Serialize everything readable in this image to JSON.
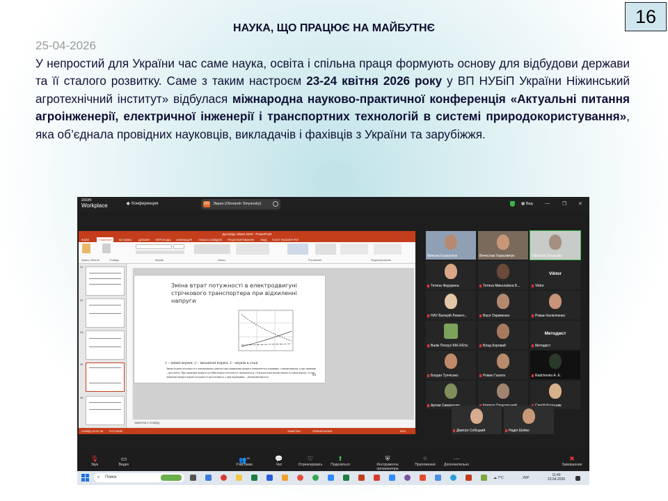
{
  "slide": {
    "title": "НАУКА, ЩО ПРАЦЮЄ НА МАЙБУТНЄ",
    "page_number": "16",
    "date": "25-04-2026",
    "p1": "У непростий для України час саме наука, освіта і спільна праця формують основу для відбудови держави та її сталого розвитку. Саме з таким настроєм ",
    "p2_bold": "23-24 квітня 2026 року",
    "p3": " у ВП НУБіП України Ніжинський агротехнічний інститут» відбулася ",
    "p4_bold": "міжнародна науково-практичної конференція «Актуальні питання агроінженерії, електричної інженерії і транспортних технологій в системі природокористування»",
    "p5": ", яка об’єднала провідних науковців, викладачів і фахівців з України та зарубіжжя."
  },
  "zoom": {
    "logo_top": "zoom",
    "logo_bottom": "Workplace",
    "conference_label": "Конференция",
    "screen_badge": "OS",
    "screen_label": "Экран (Olexandr Sinyavsky)",
    "view_label": "Вид",
    "controls": {
      "audio": "Звук",
      "video": "Видео",
      "participants": "Участники",
      "participants_count": "20",
      "chat": "Чат",
      "react": "Отреагировать",
      "share": "Поделиться",
      "host_tools": "Инструменты организатора",
      "apps": "Приложения",
      "more": "Дополнительно",
      "end": "Завершение"
    },
    "participants": [
      {
        "name": "Микола Іськальчук"
      },
      {
        "name": "Вячеслав Герасимчук"
      },
      {
        "name": "Olexandr Sinyavsky"
      },
      {
        "name": "Тетяна Федорина"
      },
      {
        "name": "Тетяна Миколаївна Б..."
      },
      {
        "name": "Viktor",
        "big": "Viktor"
      },
      {
        "name": "НАУ Валерій Лемент..."
      },
      {
        "name": "Вася Окрименко"
      },
      {
        "name": "Роман Калініченко"
      },
      {
        "name": "Валік Петрух БМ-242ск"
      },
      {
        "name": "Влад Коровай"
      },
      {
        "name": "Методист",
        "big": "Методист"
      },
      {
        "name": "Богдан Тупчієнко"
      },
      {
        "name": "Роман Галата"
      },
      {
        "name": "Radchenko A. E."
      },
      {
        "name": "Артем Симоненко"
      },
      {
        "name": "Кирилл Одосовський"
      },
      {
        "name": "Сергій Колєсник"
      },
      {
        "name": "Дмитро Собіщкий"
      },
      {
        "name": "Надія Шейко"
      }
    ]
  },
  "ppt": {
    "window_title": "Доповідь Ніжин 2026 - PowerPoint",
    "tabs": [
      "ФАЙЛ",
      "ГЛАВНАЯ",
      "ВСТАВКА",
      "ДИЗАЙН",
      "ПЕРЕХОДЫ",
      "АНИМАЦИЯ",
      "ПОКАЗ СЛАЙДОВ",
      "РЕЦЕНЗИРОВАНИЕ",
      "ВИД",
      "FOXIT READER PDF"
    ],
    "ribbon_groups": [
      "Буфер обмена",
      "Слайды",
      "Шрифт",
      "Абзац",
      "Рисование",
      "Редактирование"
    ],
    "thumb_numbers": [
      "21",
      "22",
      "23",
      "24",
      "25"
    ],
    "slide_title": "Зміна втрат потужності в електродвигуні стрічкового транспортера при відхиленні напруги",
    "caption": "1 – змінні втрати; 2 – механічні втрати; 3 – втрати в сталі",
    "paragraph": "Змінні втрати потужності в асинхронному двигуні при підвищенні напруги зменшуються порівняно з номінальними, а при зниженні – зростають. При зниженні напруги постійні втрати потужності зменшуються. Оскільки вони значно менші за змінні втрати, то при зниженні напруги втрати потужності зростатимуть, а при підвищенні – зменшуватимуться",
    "slide_page": "24",
    "notes": "Заметки к слайду",
    "status_left": "СЛАЙД 24 ИЗ 36",
    "status_lang": "РУССКИЙ",
    "status_notes": "ЗАМЕТКИ",
    "status_comments": "ПРИМЕЧАНИЯ",
    "zoom_pct": "59%"
  },
  "taskbar": {
    "search": "Поиск",
    "weather": "7°C",
    "lang": "УКР",
    "time": "11:49",
    "date": "23.04.2026"
  }
}
